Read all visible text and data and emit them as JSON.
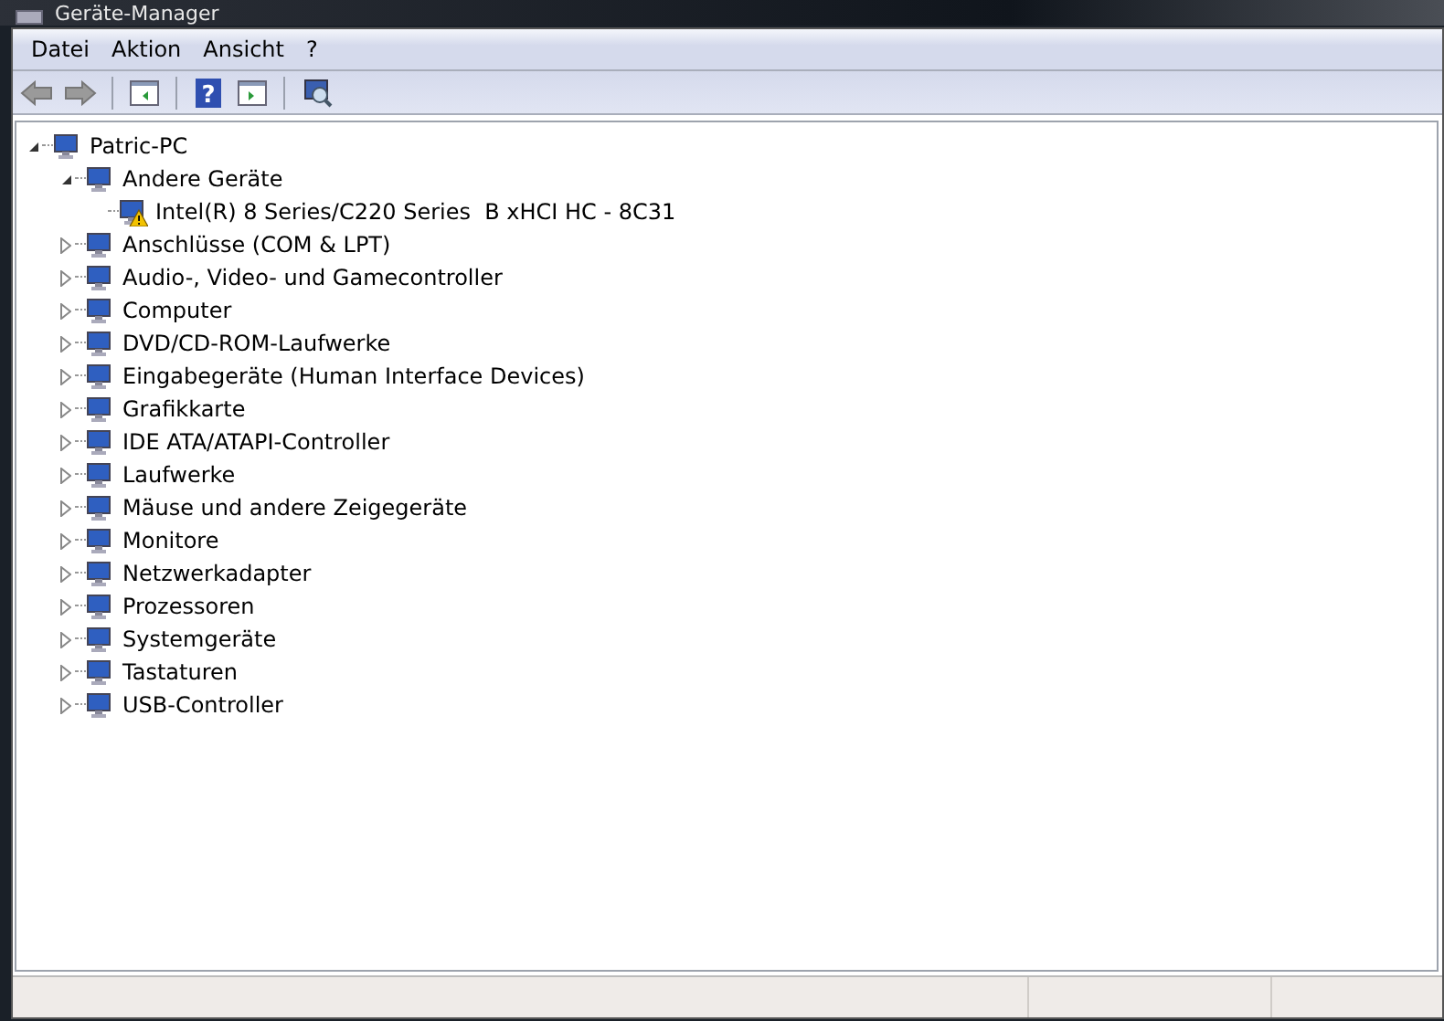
{
  "window": {
    "title": "Geräte-Manager"
  },
  "menu": [
    "Datei",
    "Aktion",
    "Ansicht",
    "?"
  ],
  "toolbar": {
    "help_glyph": "?"
  },
  "tree": [
    {
      "label": "Patric-PC",
      "expanded": true,
      "children": [
        {
          "label": "Andere Geräte",
          "expanded": true,
          "children": [
            {
              "label": "Intel(R) 8 Series/C220 Series  B xHCI HC - 8C31",
              "warning": true
            }
          ]
        },
        {
          "label": "Anschlüsse (COM & LPT)",
          "expanded": false
        },
        {
          "label": "Audio-, Video- und Gamecontroller",
          "expanded": false
        },
        {
          "label": "Computer",
          "expanded": false
        },
        {
          "label": "DVD/CD-ROM-Laufwerke",
          "expanded": false
        },
        {
          "label": "Eingabegeräte (Human Interface Devices)",
          "expanded": false
        },
        {
          "label": "Grafikkarte",
          "expanded": false
        },
        {
          "label": "IDE ATA/ATAPI-Controller",
          "expanded": false
        },
        {
          "label": "Laufwerke",
          "expanded": false
        },
        {
          "label": "Mäuse und andere Zeigegeräte",
          "expanded": false
        },
        {
          "label": "Monitore",
          "expanded": false
        },
        {
          "label": "Netzwerkadapter",
          "expanded": false
        },
        {
          "label": "Prozessoren",
          "expanded": false
        },
        {
          "label": "Systemgeräte",
          "expanded": false
        },
        {
          "label": "Tastaturen",
          "expanded": false
        },
        {
          "label": "USB-Controller",
          "expanded": false
        }
      ]
    }
  ]
}
